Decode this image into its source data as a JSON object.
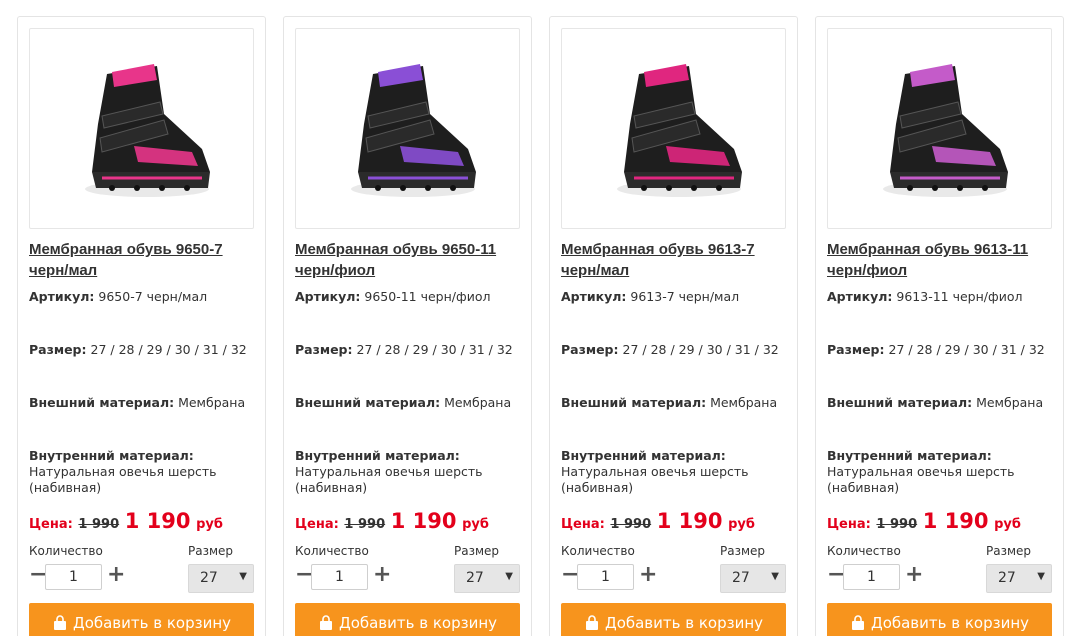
{
  "labels": {
    "price": "Цена:",
    "article": "Артикул:",
    "size": "Размер:",
    "outer": "Внешний материал:",
    "inner": "Внутренний материал:",
    "quantity": "Количество",
    "size_select": "Размер",
    "currency": "руб",
    "add_to_cart": "Добавить в корзину"
  },
  "products": [
    {
      "title": "Мембранная обувь 9650-7 черн/мал",
      "article": "9650-7 черн/мал",
      "sizes": "27 / 28 / 29 / 30 / 31 / 32",
      "outer": "Мембрана",
      "inner": "Натуральная овечья шерсть (набивная)",
      "old_price": "1 990",
      "new_price": "1 190",
      "qty": "1",
      "size": "27",
      "accent": "#e8358a"
    },
    {
      "title": "Мембранная обувь 9650-11 черн/фиол",
      "article": "9650-11 черн/фиол",
      "sizes": "27 / 28 / 29 / 30 / 31 / 32",
      "outer": "Мембрана",
      "inner": "Натуральная овечья шерсть (набивная)",
      "old_price": "1 990",
      "new_price": "1 190",
      "qty": "1",
      "size": "27",
      "accent": "#8a4fd6"
    },
    {
      "title": "Мембранная обувь 9613-7 черн/мал",
      "article": "9613-7 черн/мал",
      "sizes": "27 / 28 / 29 / 30 / 31 / 32",
      "outer": "Мембрана",
      "inner": "Натуральная овечья шерсть (набивная)",
      "old_price": "1 990",
      "new_price": "1 190",
      "qty": "1",
      "size": "27",
      "accent": "#e0267f"
    },
    {
      "title": "Мембранная обувь 9613-11 черн/фиол",
      "article": "9613-11 черн/фиол",
      "sizes": "27 / 28 / 29 / 30 / 31 / 32",
      "outer": "Мембрана",
      "inner": "Натуральная овечья шерсть (набивная)",
      "old_price": "1 990",
      "new_price": "1 190",
      "qty": "1",
      "size": "27",
      "accent": "#c45bc9"
    }
  ],
  "icons": {
    "cart": "shopping-bag-icon",
    "minus": "minus-icon",
    "plus": "plus-icon",
    "dropdown": "chevron-down-icon"
  },
  "colors": {
    "price": "#e3001b",
    "button": "#f7941d"
  }
}
